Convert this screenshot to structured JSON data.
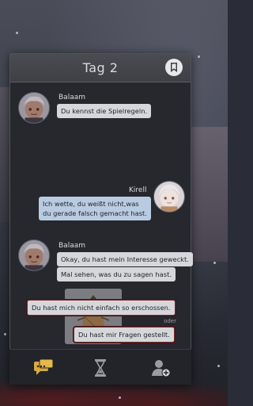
{
  "header": {
    "title": "Tag 2"
  },
  "messages": [
    {
      "speaker": "Balaam",
      "lines": [
        "Du kennst die Spielregeln."
      ]
    },
    {
      "speaker": "Kirell",
      "lines": [
        "Ich wette, du weißt nicht,was",
        "du gerade falsch gemacht hast."
      ]
    },
    {
      "speaker": "Balaam",
      "lines": [
        "Okay, du hast mein Interesse geweckt.",
        "Mal sehen, was du zu sagen hast."
      ]
    }
  ],
  "choices": [
    {
      "label": "Du hast mich nicht einfach so erschossen."
    },
    {
      "label": "Du hast mir Fragen gestellt."
    }
  ],
  "or_label": "oder",
  "nav": [
    "chat-icon",
    "hourglass-icon",
    "add-contact-icon"
  ],
  "colors": {
    "accent_gold": "#d9a940",
    "choice_border": "#7a2b2b",
    "bubble_blue": "#b9cbe1",
    "bubble_gray": "#d6d7db"
  }
}
